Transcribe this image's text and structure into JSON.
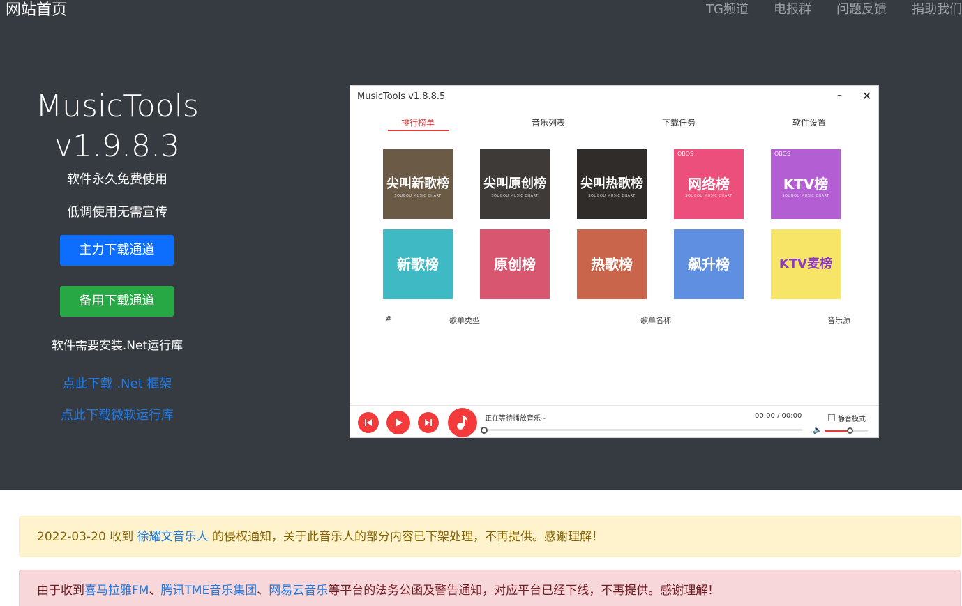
{
  "navbar": {
    "brand": "网站首页",
    "links": [
      "TG频道",
      "电报群",
      "问题反馈",
      "捐助我们"
    ]
  },
  "hero": {
    "title_line1": "MusicTools",
    "title_line2": "v1.9.8.3",
    "subtitle1": "软件永久免费使用",
    "subtitle2": "低调使用无需宣传",
    "primary_button": "主力下载通道",
    "secondary_button": "备用下载通道",
    "requirement_note": "软件需要安装.Net运行库",
    "link_net": "点此下载 .Net 框架",
    "link_runtime": "点此下载微软运行库"
  },
  "app_screenshot": {
    "window_title": "MusicTools v1.8.8.5",
    "minimize": "–",
    "close": "✕",
    "tabs": [
      "排行榜单",
      "音乐列表",
      "下载任务",
      "软件设置"
    ],
    "tiles": [
      {
        "label_line1": "尖叫",
        "label_line2": "新歌榜",
        "tag": "",
        "caption": "SOUGOU MUSIC CHART",
        "color": "#6b5a45"
      },
      {
        "label_line1": "尖叫",
        "label_line2": "原创榜",
        "tag": "",
        "caption": "SOUGOU MUSIC CHART",
        "color": "#3e3a38"
      },
      {
        "label_line1": "尖叫",
        "label_line2": "热歌榜",
        "tag": "",
        "caption": "SOUGOU MUSIC CHART",
        "color": "#2f2c29"
      },
      {
        "label_line1": "网络榜",
        "label_line2": "",
        "tag": "OBOS",
        "caption": "SOUGOU MUSIC CHART",
        "color": "#ec4f7c"
      },
      {
        "label_line1": "KTV榜",
        "label_line2": "",
        "tag": "OBOS",
        "caption": "SOUGOU MUSIC CHART",
        "color": "#b35ed2"
      },
      {
        "label_line1": "新歌榜",
        "label_line2": "",
        "tag": "",
        "caption": "",
        "color": "#3fb9c4"
      },
      {
        "label_line1": "原创榜",
        "label_line2": "",
        "tag": "",
        "caption": "",
        "color": "#d8566f"
      },
      {
        "label_line1": "热歌榜",
        "label_line2": "",
        "tag": "",
        "caption": "",
        "color": "#c9654b"
      },
      {
        "label_line1": "飙升榜",
        "label_line2": "",
        "tag": "",
        "caption": "",
        "color": "#5f8fe0"
      },
      {
        "label_line1": "KTV麦榜",
        "label_line2": "",
        "tag": "",
        "caption": "",
        "color": "#f7e567"
      }
    ],
    "columns": [
      "#",
      "歌单类型",
      "歌单名称",
      "音乐源"
    ],
    "player": {
      "status": "正在等待播放音乐~",
      "time": "00:00 / 00:00",
      "mute_label": "静音模式",
      "volume_level": 0.58
    }
  },
  "alerts": {
    "yellow": {
      "prefix": "2022-03-20 收到 ",
      "link": "徐耀文音乐人",
      "suffix": " 的侵权通知，关于此音乐人的部分内容已下架处理，不再提供。感谢理解！"
    },
    "red": {
      "prefix": "由于收到",
      "link1": "喜马拉雅FM",
      "sep1": "、",
      "link2": "腾讯TME音乐集团",
      "sep2": "、",
      "link3": "网易云音乐",
      "suffix": "等平台的法务公函及警告通知，对应平台已经下线，不再提供。感谢理解！"
    }
  }
}
